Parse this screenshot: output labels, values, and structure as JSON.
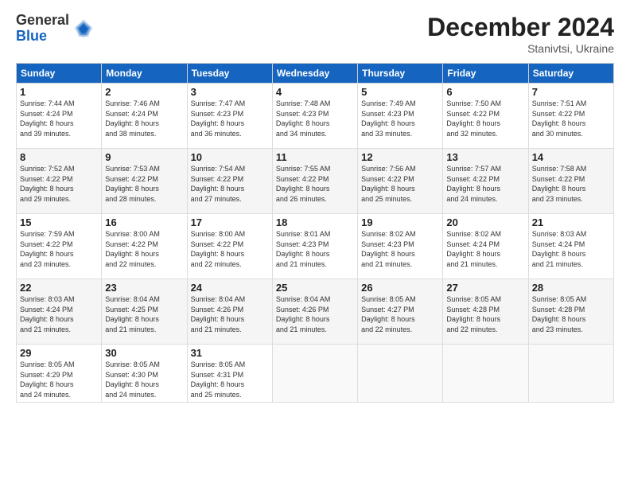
{
  "logo": {
    "general": "General",
    "blue": "Blue"
  },
  "header": {
    "month": "December 2024",
    "location": "Stanivtsi, Ukraine"
  },
  "weekdays": [
    "Sunday",
    "Monday",
    "Tuesday",
    "Wednesday",
    "Thursday",
    "Friday",
    "Saturday"
  ],
  "weeks": [
    [
      {
        "day": "1",
        "info": "Sunrise: 7:44 AM\nSunset: 4:24 PM\nDaylight: 8 hours\nand 39 minutes."
      },
      {
        "day": "2",
        "info": "Sunrise: 7:46 AM\nSunset: 4:24 PM\nDaylight: 8 hours\nand 38 minutes."
      },
      {
        "day": "3",
        "info": "Sunrise: 7:47 AM\nSunset: 4:23 PM\nDaylight: 8 hours\nand 36 minutes."
      },
      {
        "day": "4",
        "info": "Sunrise: 7:48 AM\nSunset: 4:23 PM\nDaylight: 8 hours\nand 34 minutes."
      },
      {
        "day": "5",
        "info": "Sunrise: 7:49 AM\nSunset: 4:23 PM\nDaylight: 8 hours\nand 33 minutes."
      },
      {
        "day": "6",
        "info": "Sunrise: 7:50 AM\nSunset: 4:22 PM\nDaylight: 8 hours\nand 32 minutes."
      },
      {
        "day": "7",
        "info": "Sunrise: 7:51 AM\nSunset: 4:22 PM\nDaylight: 8 hours\nand 30 minutes."
      }
    ],
    [
      {
        "day": "8",
        "info": "Sunrise: 7:52 AM\nSunset: 4:22 PM\nDaylight: 8 hours\nand 29 minutes."
      },
      {
        "day": "9",
        "info": "Sunrise: 7:53 AM\nSunset: 4:22 PM\nDaylight: 8 hours\nand 28 minutes."
      },
      {
        "day": "10",
        "info": "Sunrise: 7:54 AM\nSunset: 4:22 PM\nDaylight: 8 hours\nand 27 minutes."
      },
      {
        "day": "11",
        "info": "Sunrise: 7:55 AM\nSunset: 4:22 PM\nDaylight: 8 hours\nand 26 minutes."
      },
      {
        "day": "12",
        "info": "Sunrise: 7:56 AM\nSunset: 4:22 PM\nDaylight: 8 hours\nand 25 minutes."
      },
      {
        "day": "13",
        "info": "Sunrise: 7:57 AM\nSunset: 4:22 PM\nDaylight: 8 hours\nand 24 minutes."
      },
      {
        "day": "14",
        "info": "Sunrise: 7:58 AM\nSunset: 4:22 PM\nDaylight: 8 hours\nand 23 minutes."
      }
    ],
    [
      {
        "day": "15",
        "info": "Sunrise: 7:59 AM\nSunset: 4:22 PM\nDaylight: 8 hours\nand 23 minutes."
      },
      {
        "day": "16",
        "info": "Sunrise: 8:00 AM\nSunset: 4:22 PM\nDaylight: 8 hours\nand 22 minutes."
      },
      {
        "day": "17",
        "info": "Sunrise: 8:00 AM\nSunset: 4:22 PM\nDaylight: 8 hours\nand 22 minutes."
      },
      {
        "day": "18",
        "info": "Sunrise: 8:01 AM\nSunset: 4:23 PM\nDaylight: 8 hours\nand 21 minutes."
      },
      {
        "day": "19",
        "info": "Sunrise: 8:02 AM\nSunset: 4:23 PM\nDaylight: 8 hours\nand 21 minutes."
      },
      {
        "day": "20",
        "info": "Sunrise: 8:02 AM\nSunset: 4:24 PM\nDaylight: 8 hours\nand 21 minutes."
      },
      {
        "day": "21",
        "info": "Sunrise: 8:03 AM\nSunset: 4:24 PM\nDaylight: 8 hours\nand 21 minutes."
      }
    ],
    [
      {
        "day": "22",
        "info": "Sunrise: 8:03 AM\nSunset: 4:24 PM\nDaylight: 8 hours\nand 21 minutes."
      },
      {
        "day": "23",
        "info": "Sunrise: 8:04 AM\nSunset: 4:25 PM\nDaylight: 8 hours\nand 21 minutes."
      },
      {
        "day": "24",
        "info": "Sunrise: 8:04 AM\nSunset: 4:26 PM\nDaylight: 8 hours\nand 21 minutes."
      },
      {
        "day": "25",
        "info": "Sunrise: 8:04 AM\nSunset: 4:26 PM\nDaylight: 8 hours\nand 21 minutes."
      },
      {
        "day": "26",
        "info": "Sunrise: 8:05 AM\nSunset: 4:27 PM\nDaylight: 8 hours\nand 22 minutes."
      },
      {
        "day": "27",
        "info": "Sunrise: 8:05 AM\nSunset: 4:28 PM\nDaylight: 8 hours\nand 22 minutes."
      },
      {
        "day": "28",
        "info": "Sunrise: 8:05 AM\nSunset: 4:28 PM\nDaylight: 8 hours\nand 23 minutes."
      }
    ],
    [
      {
        "day": "29",
        "info": "Sunrise: 8:05 AM\nSunset: 4:29 PM\nDaylight: 8 hours\nand 24 minutes."
      },
      {
        "day": "30",
        "info": "Sunrise: 8:05 AM\nSunset: 4:30 PM\nDaylight: 8 hours\nand 24 minutes."
      },
      {
        "day": "31",
        "info": "Sunrise: 8:05 AM\nSunset: 4:31 PM\nDaylight: 8 hours\nand 25 minutes."
      },
      {
        "day": "",
        "info": ""
      },
      {
        "day": "",
        "info": ""
      },
      {
        "day": "",
        "info": ""
      },
      {
        "day": "",
        "info": ""
      }
    ]
  ]
}
